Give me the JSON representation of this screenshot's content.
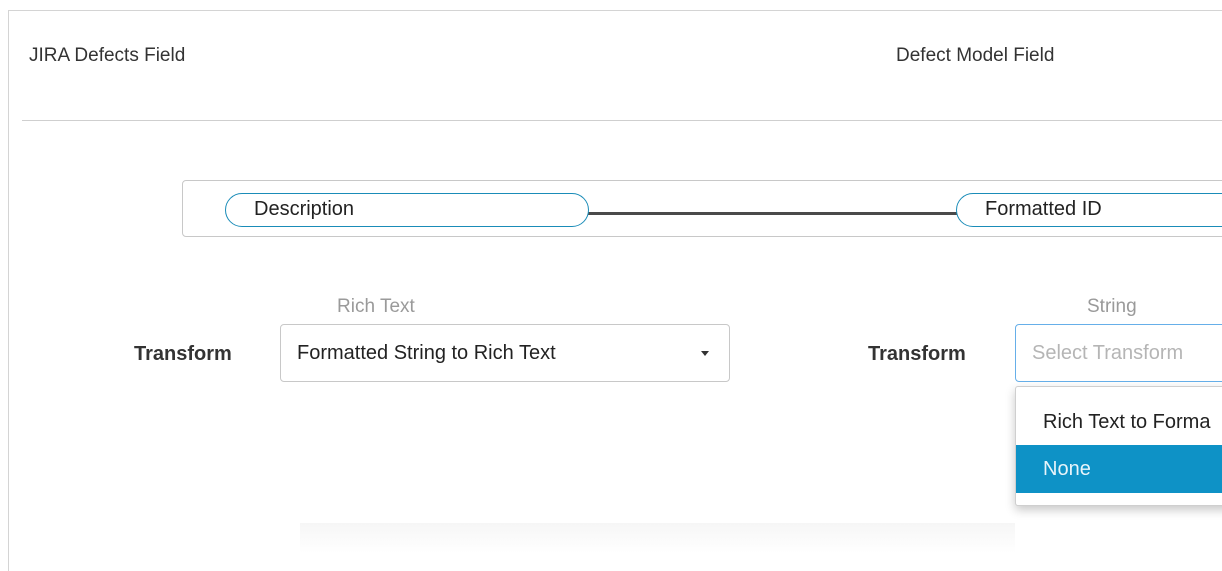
{
  "headers": {
    "left": "JIRA Defects Field",
    "right": "Defect Model Field"
  },
  "mapping": {
    "source_field": "Description",
    "target_field": "Formatted ID"
  },
  "left_transform": {
    "type_label": "Rich Text",
    "label": "Transform",
    "selected_value": "Formatted String to Rich Text"
  },
  "right_transform": {
    "type_label": "String",
    "label": "Transform",
    "placeholder": "Select Transform",
    "options": [
      {
        "label": "Rich Text to Forma",
        "highlighted": false
      },
      {
        "label": "None",
        "highlighted": true
      }
    ]
  },
  "colors": {
    "accent": "#1a8cb8",
    "highlight": "#0e92c6"
  }
}
